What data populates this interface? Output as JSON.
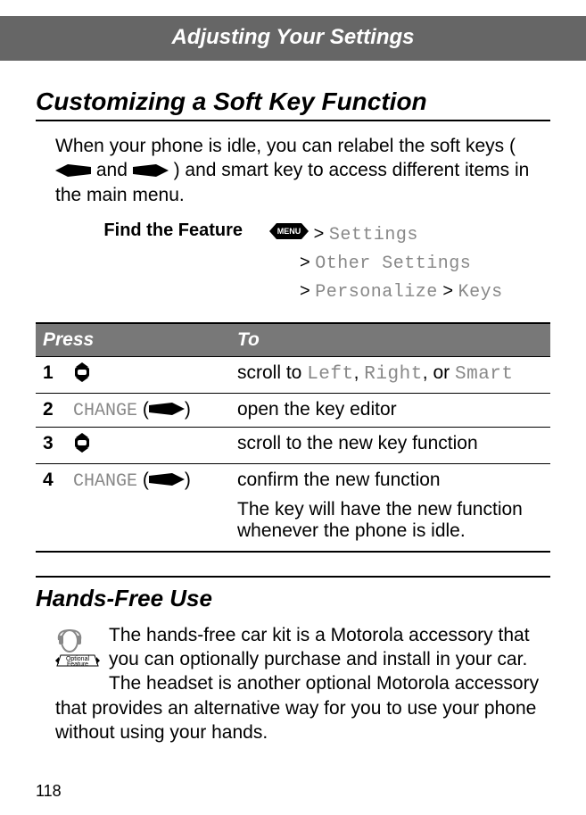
{
  "chapter_title": "Adjusting Your Settings",
  "section1_title": "Customizing a Soft Key Function",
  "intro_pre": "When your phone is idle, you can relabel the soft keys (",
  "intro_mid": " and ",
  "intro_post": ") and smart key to access different items in the main menu.",
  "find_feature_label": "Find the Feature",
  "path_settings": "Settings",
  "path_other": "Other Settings",
  "path_personalize": "Personalize",
  "path_keys": "Keys",
  "gt": ">",
  "table": {
    "col_press": "Press",
    "col_to": "To"
  },
  "steps": {
    "n1": "1",
    "n2": "2",
    "n3": "3",
    "n4": "4",
    "change_label": "CHANGE",
    "paren_open": " (",
    "paren_close": ")",
    "to1_pre": "scroll to ",
    "opt_left": "Left",
    "comma_sp": ", ",
    "opt_right": "Right",
    "comma_or": ", or ",
    "opt_smart": "Smart",
    "to2": "open the key editor",
    "to3": "scroll to the new key function",
    "to4a": "confirm the new function",
    "to4b": "The key will have the new function whenever the phone is idle."
  },
  "section2_title": "Hands-Free Use",
  "hands_text": "The hands-free car kit is a Motorola accessory that you can optionally purchase and install in your car. The headset is another optional Motorola accessory that provides an alternative way for you to use your phone without using your hands.",
  "page_number": "118"
}
